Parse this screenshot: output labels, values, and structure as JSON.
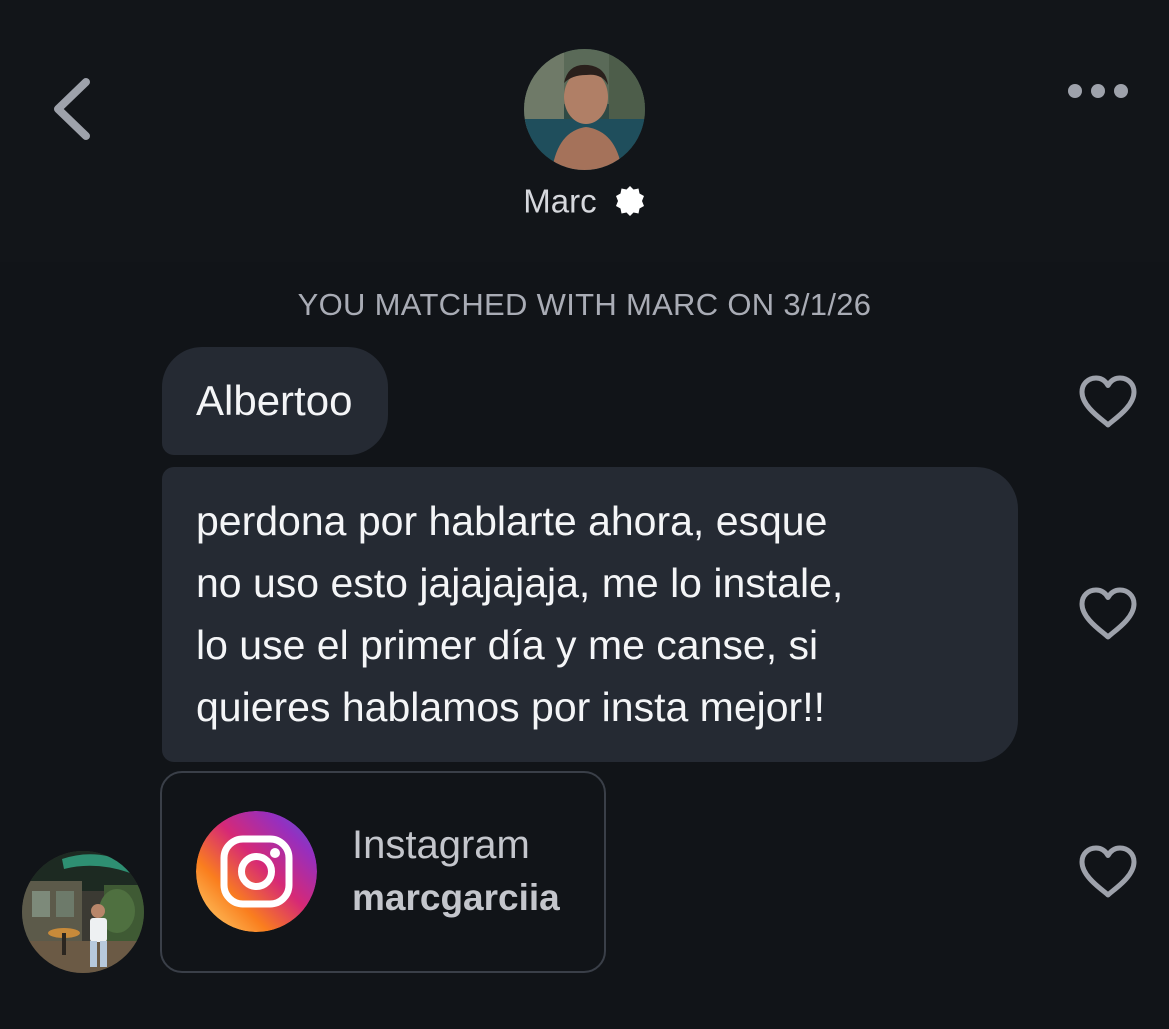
{
  "header": {
    "back_icon": "chevron-left-icon",
    "more_icon": "more-horizontal-icon",
    "contact_name": "Marc",
    "verified_icon": "verified-badge-icon"
  },
  "conversation": {
    "match_notice": "YOU MATCHED WITH MARC ON 3/1/26",
    "messages": [
      {
        "text": "Albertoo",
        "liked": false
      },
      {
        "lines": [
          "perdona por hablarte ahora, esque",
          "no uso esto jajajajaja, me lo instale,",
          "lo use el primer día y me canse, si",
          "quieres hablamos por insta mejor!!"
        ],
        "liked": false
      },
      {
        "type": "instagram-card",
        "platform": "Instagram",
        "handle": "marcgarciia",
        "liked": false
      }
    ]
  },
  "colors": {
    "background": "#111418",
    "bubble": "#252a33",
    "text": "#f4f5f7",
    "muted_text": "#a9acb5",
    "icon_gray": "#9ea2ab",
    "instagram_gradient": [
      "#feda75",
      "#fa7e1e",
      "#d62976",
      "#962fbf",
      "#4f5bd5"
    ]
  }
}
